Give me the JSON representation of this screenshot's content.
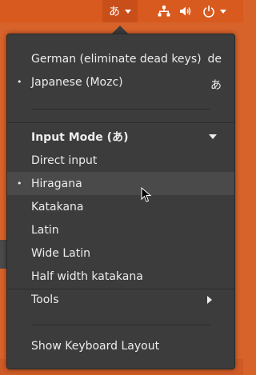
{
  "topbar": {
    "ime_indicator": "あ",
    "icons": [
      "network-icon",
      "volume-icon",
      "power-icon",
      "chevron-down-icon"
    ]
  },
  "menu": {
    "layouts": [
      {
        "label": "German (eliminate dead keys)",
        "shortcut": "de",
        "selected": false
      },
      {
        "label": "Japanese (Mozc)",
        "shortcut": "あ",
        "selected": true
      }
    ],
    "input_mode_header": "Input Mode (あ)",
    "modes": [
      {
        "label": "Direct input",
        "selected": false
      },
      {
        "label": "Hiragana",
        "selected": true
      },
      {
        "label": "Katakana",
        "selected": false
      },
      {
        "label": "Latin",
        "selected": false
      },
      {
        "label": "Wide Latin",
        "selected": false
      },
      {
        "label": "Half width katakana",
        "selected": false
      }
    ],
    "tools_label": "Tools",
    "show_layout_label": "Show Keyboard Layout",
    "bullet": "•"
  },
  "colors": {
    "panel_accent": "#d85a1e",
    "menu_bg": "#3c3c3c",
    "text": "#ececec"
  }
}
